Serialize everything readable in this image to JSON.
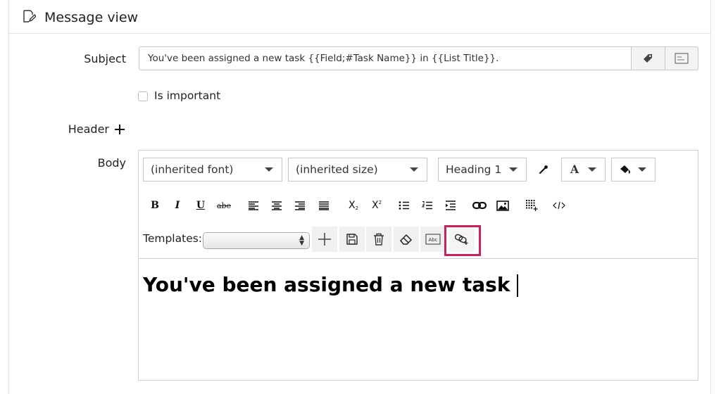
{
  "panel": {
    "title": "Message view"
  },
  "form": {
    "subject_label": "Subject",
    "subject_value": "You've been assigned a new task {{Field;#Task Name}} in {{List Title}}.",
    "important_label": "Is important",
    "header_label": "Header",
    "body_label": "Body"
  },
  "toolbar": {
    "font_value": "(inherited font)",
    "size_value": "(inherited size)",
    "format_value": "Heading 1",
    "bold": "B",
    "italic": "I",
    "underline": "U",
    "strike": "abe",
    "subscript": "X",
    "superscript": "X",
    "forecolor_label": "A"
  },
  "templates": {
    "label": "Templates:",
    "selected": ""
  },
  "editor": {
    "content": "You've been assigned a new task"
  },
  "colors": {
    "highlight": "#c8245a",
    "border": "#c8c8c8"
  }
}
